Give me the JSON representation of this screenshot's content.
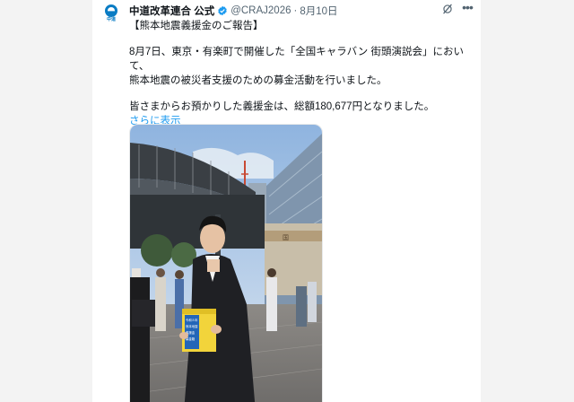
{
  "tweet": {
    "display_name": "中道改革連合 公式",
    "handle": "@CRAJ2026",
    "separator": "·",
    "date": "8月10日",
    "avatar_text": "中道",
    "lines": [
      "【熊本地震義援金のご報告】",
      "8月7日、東京・有楽町で開催した「全国キャラバン 街頭演説会」において、",
      "熊本地震の被災者支援のための募金活動を行いました。",
      "皆さまからお預かりした義援金は、総額180,677円となりました。"
    ],
    "show_more": "さらに表示"
  },
  "photo": {
    "box_text": [
      "令和８年",
      "熊本地震",
      "義援金",
      "募金箱"
    ]
  },
  "colors": {
    "link": "#1d9bf0",
    "verified": "#1d9bf0",
    "secondary_text": "#536471"
  },
  "icons": {
    "verified": "verified-badge-icon",
    "grok": "grok-icon",
    "more": "more-icon"
  }
}
